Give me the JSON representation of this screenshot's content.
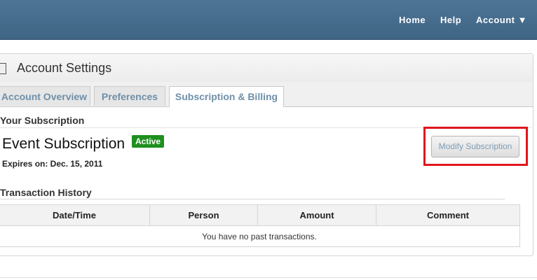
{
  "nav": {
    "home": "Home",
    "help": "Help",
    "account": "Account ▼"
  },
  "panel": {
    "title": "Account Settings"
  },
  "tabs": [
    {
      "label": "Account Overview",
      "active": false
    },
    {
      "label": "Preferences",
      "active": false
    },
    {
      "label": "Subscription & Billing",
      "active": true
    }
  ],
  "subscription": {
    "heading": "Your Subscription",
    "name": "Event Subscription",
    "status": "Active",
    "expires": "Expires on: Dec. 15, 2011",
    "modify_button": "Modify Subscription"
  },
  "transactions": {
    "heading": "Transaction History",
    "columns": [
      "Date/Time",
      "Person",
      "Amount",
      "Comment"
    ],
    "empty_message": "You have no past transactions."
  },
  "colors": {
    "topbar": "#46698a",
    "status_badge": "#1f8f1f",
    "highlight": "#e1161d"
  }
}
